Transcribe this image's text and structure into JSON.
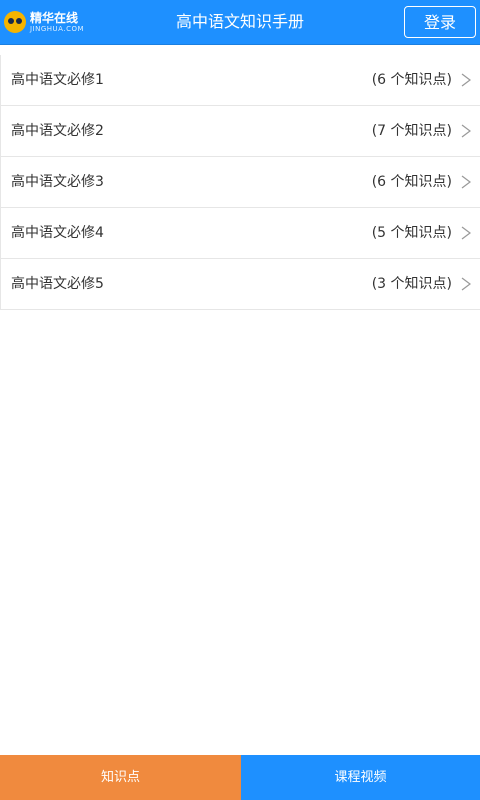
{
  "header": {
    "logo_text": "精华在线",
    "logo_subtext": "JINGHUA.COM",
    "title": "高中语文知识手册",
    "login_label": "登录"
  },
  "list": {
    "items": [
      {
        "title": "高中语文必修1",
        "count": "(6 个知识点)"
      },
      {
        "title": "高中语文必修2",
        "count": "(7 个知识点)"
      },
      {
        "title": "高中语文必修3",
        "count": "(6 个知识点)"
      },
      {
        "title": "高中语文必修4",
        "count": "(5 个知识点)"
      },
      {
        "title": "高中语文必修5",
        "count": "(3 个知识点)"
      }
    ]
  },
  "tabs": {
    "knowledge": "知识点",
    "video": "课程视频"
  },
  "colors": {
    "header_bg": "#1e90ff",
    "tab_active_bg": "#f08a3e",
    "tab_inactive_bg": "#1e90ff"
  },
  "icons": {
    "logo": "jinghua-logo-icon",
    "chevron": "chevron-right-icon"
  }
}
